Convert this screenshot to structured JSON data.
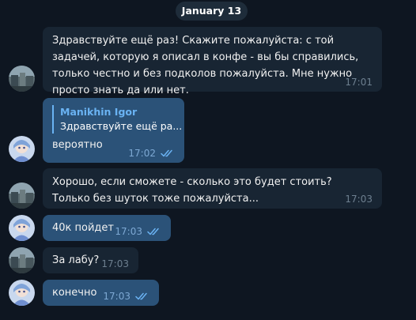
{
  "date_label": "January 13",
  "messages": [
    {
      "text": "Здравствуйте ещё раз! Скажите пожалуйста: с той задачей, которую я описал в конфе - вы бы справились, только честно и без подколов пожалуйста. Мне нужно просто знать да или нет.",
      "time": "17:01"
    },
    {
      "reply_name": "Manikhin Igor",
      "reply_text": "Здравствуйте ещё ра...",
      "text": "вероятно",
      "time": "17:02"
    },
    {
      "text": "Хорошо, если сможете - сколько это будет стоить? Только без шуток тоже пожалуйста...",
      "time": "17:03"
    },
    {
      "text": "40к пойдет",
      "time": "17:03"
    },
    {
      "text": "За лабу?",
      "time": "17:03"
    },
    {
      "text": "конечно",
      "time": "17:03"
    }
  ],
  "colors": {
    "background": "#0e1621",
    "incoming_bubble": "#182533",
    "outgoing_bubble": "#2b5278",
    "accent": "#6ab3f3"
  },
  "icons": {
    "read_receipt": "double-check-icon"
  }
}
